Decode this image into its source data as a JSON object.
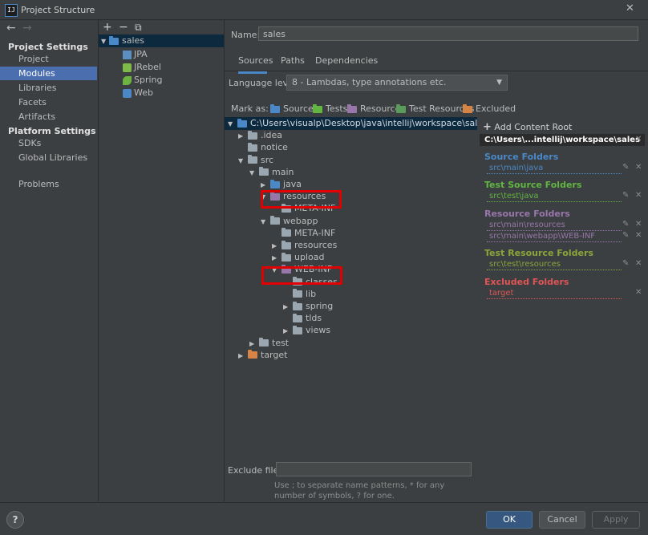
{
  "window": {
    "title": "Project Structure",
    "app_icon_text": "IJ",
    "close": "✕"
  },
  "nav": {
    "back": "←",
    "forward": "→",
    "project_settings_header": "Project Settings",
    "project_settings": [
      "Project",
      "Modules",
      "Libraries",
      "Facets",
      "Artifacts"
    ],
    "platform_settings_header": "Platform Settings",
    "platform_settings": [
      "SDKs",
      "Global Libraries"
    ],
    "problems": "Problems"
  },
  "modules": {
    "add": "+",
    "remove": "−",
    "copy": "⧉",
    "items": [
      {
        "label": "sales",
        "expanded": true
      },
      {
        "label": "JPA"
      },
      {
        "label": "JRebel"
      },
      {
        "label": "Spring"
      },
      {
        "label": "Web"
      }
    ]
  },
  "name_field": {
    "label": "Name:",
    "value": "sales"
  },
  "tabs": [
    "Sources",
    "Paths",
    "Dependencies"
  ],
  "language_level": {
    "label": "Language level:",
    "value": "8 - Lambdas, type annotations etc."
  },
  "mark_as": {
    "label": "Mark as:",
    "options": [
      "Sources",
      "Tests",
      "Resources",
      "Test Resources",
      "Excluded"
    ]
  },
  "tree": [
    {
      "label": "C:\\Users\\visualp\\Desktop\\java\\intellij\\workspace\\sales",
      "depth": 0,
      "arrow": "▼",
      "color": "blue"
    },
    {
      "label": ".idea",
      "depth": 1,
      "arrow": "▶",
      "color": "grey"
    },
    {
      "label": "notice",
      "depth": 1,
      "arrow": "",
      "color": "grey"
    },
    {
      "label": "src",
      "depth": 1,
      "arrow": "▼",
      "color": "grey"
    },
    {
      "label": "main",
      "depth": 2,
      "arrow": "▼",
      "color": "grey"
    },
    {
      "label": "java",
      "depth": 3,
      "arrow": "▶",
      "color": "blue"
    },
    {
      "label": "resources",
      "depth": 3,
      "arrow": "▼",
      "color": "purple",
      "highlight": true
    },
    {
      "label": "META-INF",
      "depth": 4,
      "arrow": "",
      "color": "grey"
    },
    {
      "label": "webapp",
      "depth": 3,
      "arrow": "▼",
      "color": "grey"
    },
    {
      "label": "META-INF",
      "depth": 4,
      "arrow": "",
      "color": "grey"
    },
    {
      "label": "resources",
      "depth": 4,
      "arrow": "▶",
      "color": "grey"
    },
    {
      "label": "upload",
      "depth": 4,
      "arrow": "▶",
      "color": "grey"
    },
    {
      "label": "WEB-INF",
      "depth": 4,
      "arrow": "▼",
      "color": "purple",
      "highlight": true
    },
    {
      "label": "classes",
      "depth": 5,
      "arrow": "",
      "color": "grey"
    },
    {
      "label": "lib",
      "depth": 5,
      "arrow": "",
      "color": "grey"
    },
    {
      "label": "spring",
      "depth": 5,
      "arrow": "▶",
      "color": "grey"
    },
    {
      "label": "tlds",
      "depth": 5,
      "arrow": "",
      "color": "grey"
    },
    {
      "label": "views",
      "depth": 5,
      "arrow": "▶",
      "color": "grey"
    },
    {
      "label": "test",
      "depth": 2,
      "arrow": "▶",
      "color": "grey"
    },
    {
      "label": "target",
      "depth": 1,
      "arrow": "▶",
      "color": "orange"
    }
  ],
  "content_root": {
    "add_label": "Add Content Root",
    "root_path": "C:\\Users\\...intellij\\workspace\\sales",
    "source_folders": {
      "title": "Source Folders",
      "color": "#4a88c7",
      "paths": [
        "src\\main\\java"
      ]
    },
    "test_source_folders": {
      "title": "Test Source Folders",
      "color": "#62b543",
      "paths": [
        "src\\test\\java"
      ]
    },
    "resource_folders": {
      "title": "Resource Folders",
      "color": "#9876aa",
      "paths": [
        "src\\main\\resources",
        "src\\main\\webapp\\WEB-INF"
      ]
    },
    "test_resource_folders": {
      "title": "Test Resource Folders",
      "color": "#8aa539",
      "paths": [
        "src\\test\\resources"
      ]
    },
    "excluded_folders": {
      "title": "Excluded Folders",
      "color": "#e05555",
      "paths": [
        "target"
      ]
    }
  },
  "exclude_files": {
    "label": "Exclude files:",
    "hint": "Use ; to separate name patterns, * for any number of symbols, ? for one."
  },
  "buttons": {
    "help": "?",
    "ok": "OK",
    "cancel": "Cancel",
    "apply": "Apply"
  }
}
